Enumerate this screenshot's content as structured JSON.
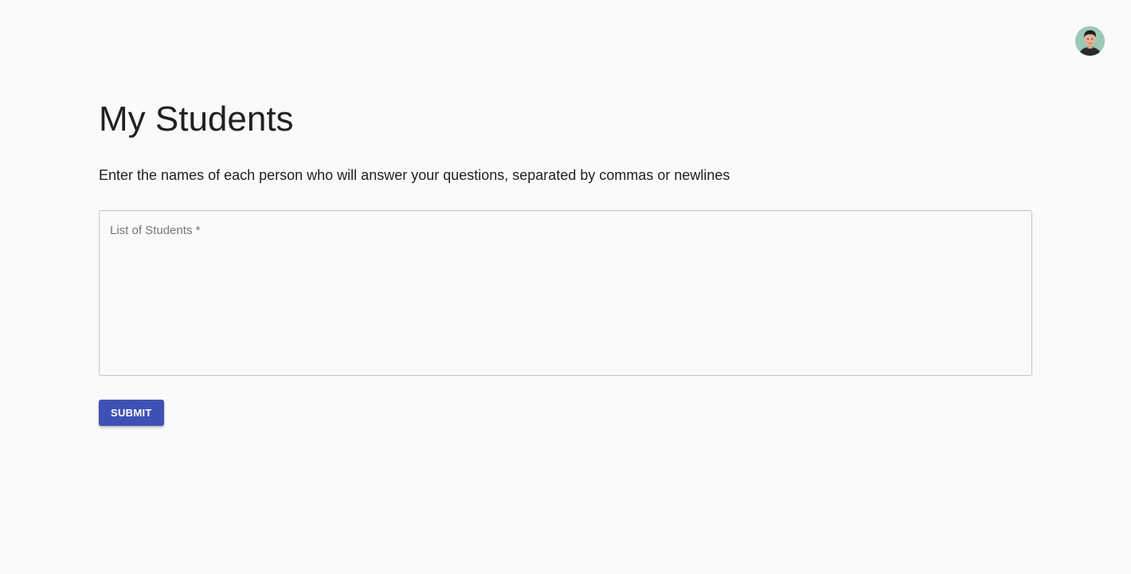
{
  "header": {
    "avatar_icon": "user-avatar-photo"
  },
  "main": {
    "title": "My Students",
    "instructions": "Enter the names of each person who will answer your questions, separated by commas or newlines",
    "students_field": {
      "placeholder": "List of Students *",
      "value": ""
    },
    "submit_label": "SUBMIT"
  },
  "colors": {
    "background": "#fafafa",
    "primary": "#3f51b5",
    "text": "#212121",
    "border": "#c4c4c4"
  }
}
